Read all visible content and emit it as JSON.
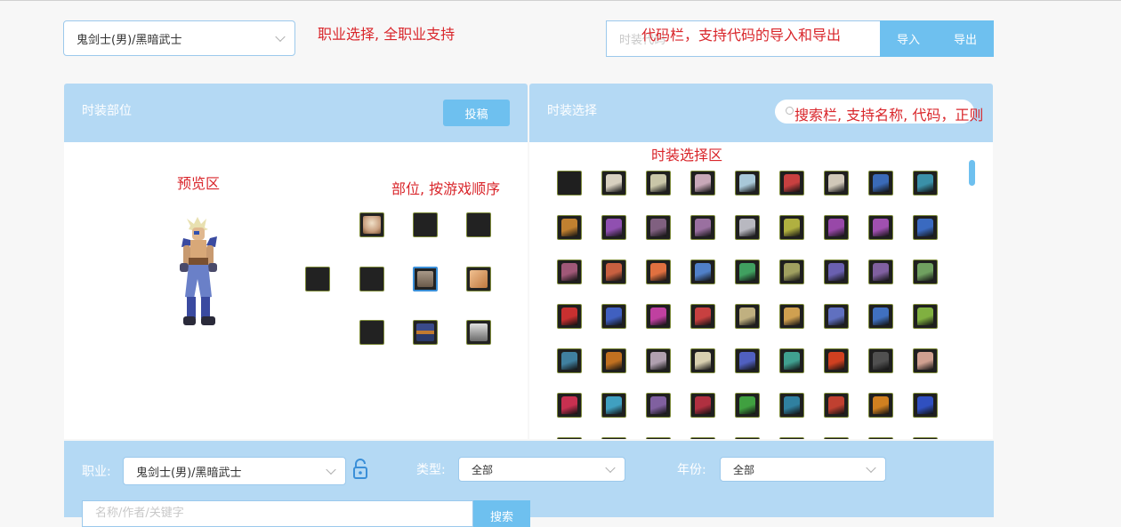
{
  "top": {
    "job_select": "鬼剑士(男)/黑暗武士",
    "code_placeholder": "时装代码",
    "import_label": "导入",
    "export_label": "导出"
  },
  "annotations": {
    "job": "职业选择, 全职业支持",
    "code": "代码栏，支持代码的导入和导出",
    "preview": "预览区",
    "parts": "部位, 按游戏顺序",
    "search": "搜索栏, 支持名称, 代码，正则",
    "selection": "时装选择区"
  },
  "left_panel": {
    "title": "时装部位",
    "submit_label": "投稿"
  },
  "right_panel": {
    "title": "时装选择",
    "search_placeholder": ""
  },
  "part_slots": [
    {
      "icon": "hair-avatar-icon",
      "color": "#c9a080"
    },
    {
      "icon": "empty-slot-icon",
      "color": ""
    },
    {
      "icon": "empty-slot-icon",
      "color": ""
    },
    {
      "icon": "empty-slot-icon",
      "color": ""
    },
    {
      "icon": "empty-slot-icon",
      "color": ""
    },
    {
      "icon": "coat-avatar-icon",
      "color": "#8a7a6a"
    },
    {
      "icon": "skin-avatar-icon",
      "color": "#d9a070"
    },
    {
      "icon": "empty-slot-icon",
      "color": ""
    },
    {
      "icon": "belt-avatar-icon",
      "color": "#c07a30"
    },
    {
      "icon": "shoes-avatar-icon",
      "color": "#9a9a9a"
    }
  ],
  "avatar_grid": [
    [
      "",
      "#d8d0c0",
      "#c9c6a8",
      "#c8a8b8",
      "#a8c8d8",
      "#c84040",
      "#d0c8b8",
      "#3a6ab8",
      "#3a90a8"
    ],
    [
      "#c08030",
      "#9050b0",
      "#806080",
      "#9a70a0",
      "#b8b8c0",
      "#b0b040",
      "#9848a8",
      "#a050b0",
      "#3a6ac0",
      "#3a9ab0"
    ],
    [
      "#a05878",
      "#c86040",
      "#e07040",
      "#5080c8",
      "#40a060",
      "#a0a060",
      "#6a60b0",
      "#8060a0",
      "#70a060"
    ],
    [
      "#c83030",
      "#4060c0",
      "#c040a0",
      "#c84040",
      "#c0b080",
      "#d0a050",
      "#6070c0",
      "#4070c0",
      "#80b040"
    ],
    [
      "#4080a0",
      "#c07020",
      "#b0a0b0",
      "#d8d0b0",
      "#5060c0",
      "#40a090",
      "#d04020",
      "#505050",
      "#d0a090"
    ],
    [
      "#c83050",
      "#40a0c0",
      "#8060a0",
      "#b03040",
      "#40a040",
      "#3080a0",
      "#c04030",
      "#d08020",
      "#3050c0"
    ]
  ],
  "filter": {
    "job_label": "职业:",
    "job_value": "鬼剑士(男)/黑暗武士",
    "type_label": "类型:",
    "type_value": "全部",
    "year_label": "年份:",
    "year_value": "全部",
    "name_placeholder": "名称/作者/关键字",
    "search_label": "搜索"
  }
}
